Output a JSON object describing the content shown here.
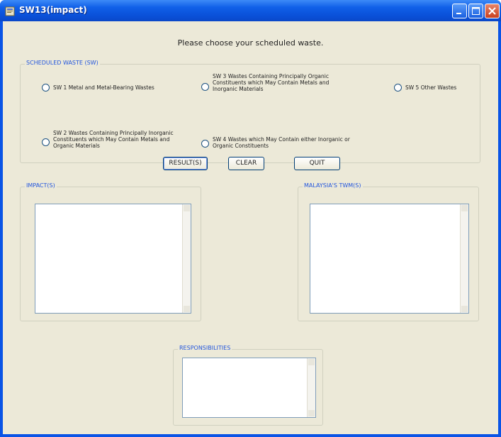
{
  "window": {
    "title": "SW13(impact)",
    "controls": {
      "minimize": "minimize",
      "maximize": "maximize",
      "close": "close"
    }
  },
  "prompt": "Please choose your scheduled waste.",
  "waste_group": {
    "legend": "SCHEDULED WASTE (SW)",
    "options": [
      {
        "label": "SW 1 Metal and Metal-Bearing Wastes"
      },
      {
        "label": "SW 2 Wastes Containing Principally Inorganic Constituents which May Contain Metals and Organic Materials"
      },
      {
        "label": "SW 3 Wastes Containing Principally Organic Constituents which May Contain Metals and Inorganic Materials"
      },
      {
        "label": "SW 4 Wastes which May Contain either Inorganic or Organic Constituents"
      },
      {
        "label": "SW 5 Other Wastes"
      }
    ]
  },
  "buttons": {
    "result": "RESULT(S)",
    "clear": "CLEAR",
    "quit": "QUIT"
  },
  "impact": {
    "legend": "IMPACT(S)",
    "value": ""
  },
  "malaysia": {
    "legend": "MALAYSIA'S TWM(S)",
    "value": ""
  },
  "responsibilities": {
    "legend": "RESPONSIBILITIES",
    "value": ""
  }
}
